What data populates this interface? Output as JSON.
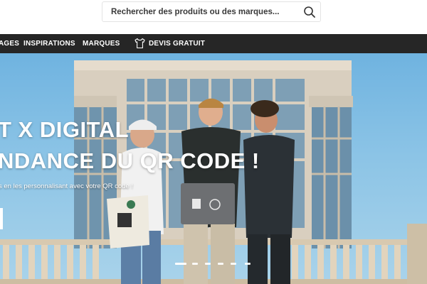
{
  "search": {
    "placeholder": "Rechercher des produits ou des marques...",
    "icon": "search-icon"
  },
  "nav": {
    "items": [
      {
        "label": "AGES"
      },
      {
        "label": "INSPIRATIONS"
      },
      {
        "label": "MARQUES"
      },
      {
        "label": "DEVIS GRATUIT",
        "icon": "tshirt-icon"
      }
    ]
  },
  "hero": {
    "title_line1": "T X DIGITAL",
    "title_line2": "NDANCE DU QR CODE !",
    "subtitle": "s en les personnalisant avec votre QR code !",
    "slides_count": 6,
    "active_slide": 1
  },
  "colors": {
    "nav_bg": "#262626",
    "text_dark": "#3a3a3a",
    "hero_text": "#ffffff"
  }
}
